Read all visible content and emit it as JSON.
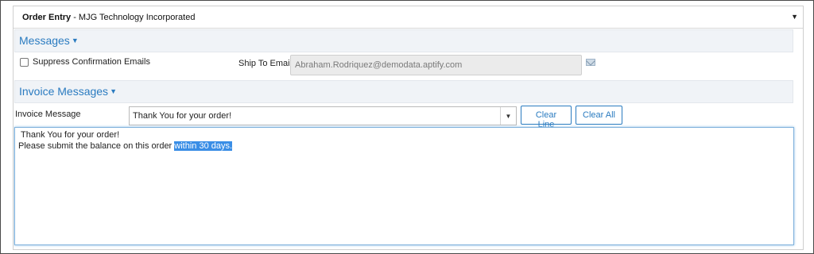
{
  "header": {
    "title_bold": "Order Entry",
    "title_rest": " - MJG Technology Incorporated",
    "caret": "▼"
  },
  "messages_section": {
    "title": "Messages",
    "caret": "▼",
    "suppress_label": "Suppress Confirmation Emails",
    "suppress_checked": false,
    "ship_to_label": "Ship To Email",
    "ship_to_value": "Abraham.Rodriquez@demodata.aptify.com"
  },
  "invoice_section": {
    "title": "Invoice Messages",
    "caret": "▼",
    "message_label": "Invoice Message",
    "message_selected": "Thank You for your order!",
    "select_caret": "▼",
    "clear_line_label": "Clear Line",
    "clear_all_label": "Clear All",
    "text_line1": "Thank You for your order!",
    "text_line2_before": "Please submit the balance on this order ",
    "text_line2_selected": "within 30 days."
  },
  "colors": {
    "accent": "#2a7bc0",
    "section_bg": "#f0f3f7",
    "selection": "#3a8ee6"
  }
}
